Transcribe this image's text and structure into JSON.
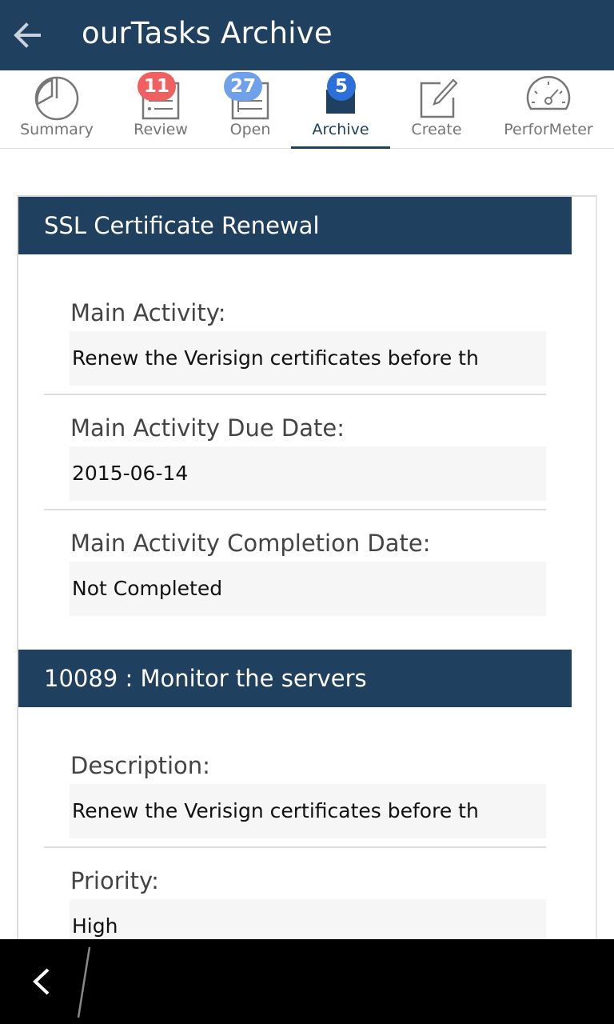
{
  "app_bar": {
    "title": "ourTasks Archive",
    "back_icon": "arrow-left-icon"
  },
  "tabs": [
    {
      "label": "Summary",
      "icon": "pie-chart-icon",
      "badge": null
    },
    {
      "label": "Review",
      "icon": "review-list-icon",
      "badge": "11",
      "badge_color": "#f06060"
    },
    {
      "label": "Open",
      "icon": "open-list-icon",
      "badge": "27",
      "badge_color": "#6fa0ea"
    },
    {
      "label": "Archive",
      "icon": "archive-box-icon",
      "badge": "5",
      "badge_color": "#2d6fd8",
      "active": true
    },
    {
      "label": "Create",
      "icon": "edit-pencil-icon",
      "badge": null
    },
    {
      "label": "PerforMeter",
      "icon": "speedometer-icon",
      "badge": null
    }
  ],
  "sections": [
    {
      "title": "SSL Certificate Renewal",
      "fields": [
        {
          "label": "Main Activity:",
          "value": "Renew the Verisign certificates before th"
        },
        {
          "label": "Main Activity Due Date:",
          "value": "2015-06-14"
        },
        {
          "label": "Main Activity Completion Date:",
          "value": "Not Completed"
        }
      ]
    },
    {
      "title": "10089 : Monitor the servers",
      "fields": [
        {
          "label": "Description:",
          "value": "Renew the Verisign certificates before th"
        },
        {
          "label": "Priority:",
          "value": "High"
        }
      ]
    }
  ],
  "colors": {
    "primary": "#20405f",
    "background": "#ffffff",
    "field_bg": "#f6f6f6"
  },
  "system_nav": {
    "back_icon": "chevron-left-icon"
  }
}
